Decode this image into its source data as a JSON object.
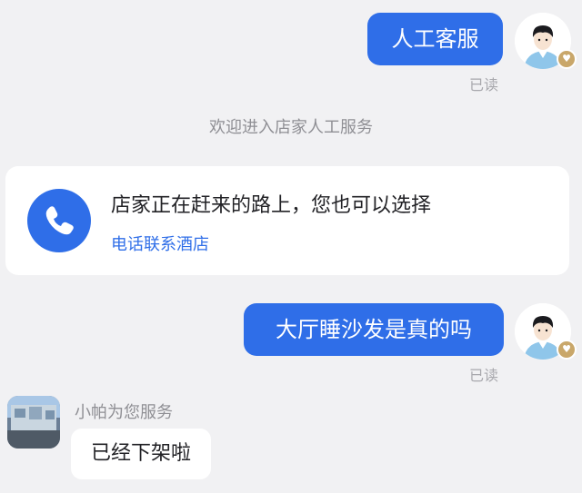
{
  "messages": {
    "msg1": {
      "text": "人工客服",
      "status": "已读"
    },
    "system_notice": "欢迎进入店家人工服务",
    "card": {
      "title": "店家正在赶来的路上，您也可以选择",
      "link": "电话联系酒店",
      "icon": "phone-icon"
    },
    "msg2": {
      "text": "大厅睡沙发是真的吗",
      "status": "已读"
    },
    "agent": {
      "name": "小帕为您服务",
      "reply": "已经下架啦"
    }
  },
  "colors": {
    "accent": "#2f6ee8",
    "background": "#f1f1f3",
    "badge": "#c9a76a"
  }
}
